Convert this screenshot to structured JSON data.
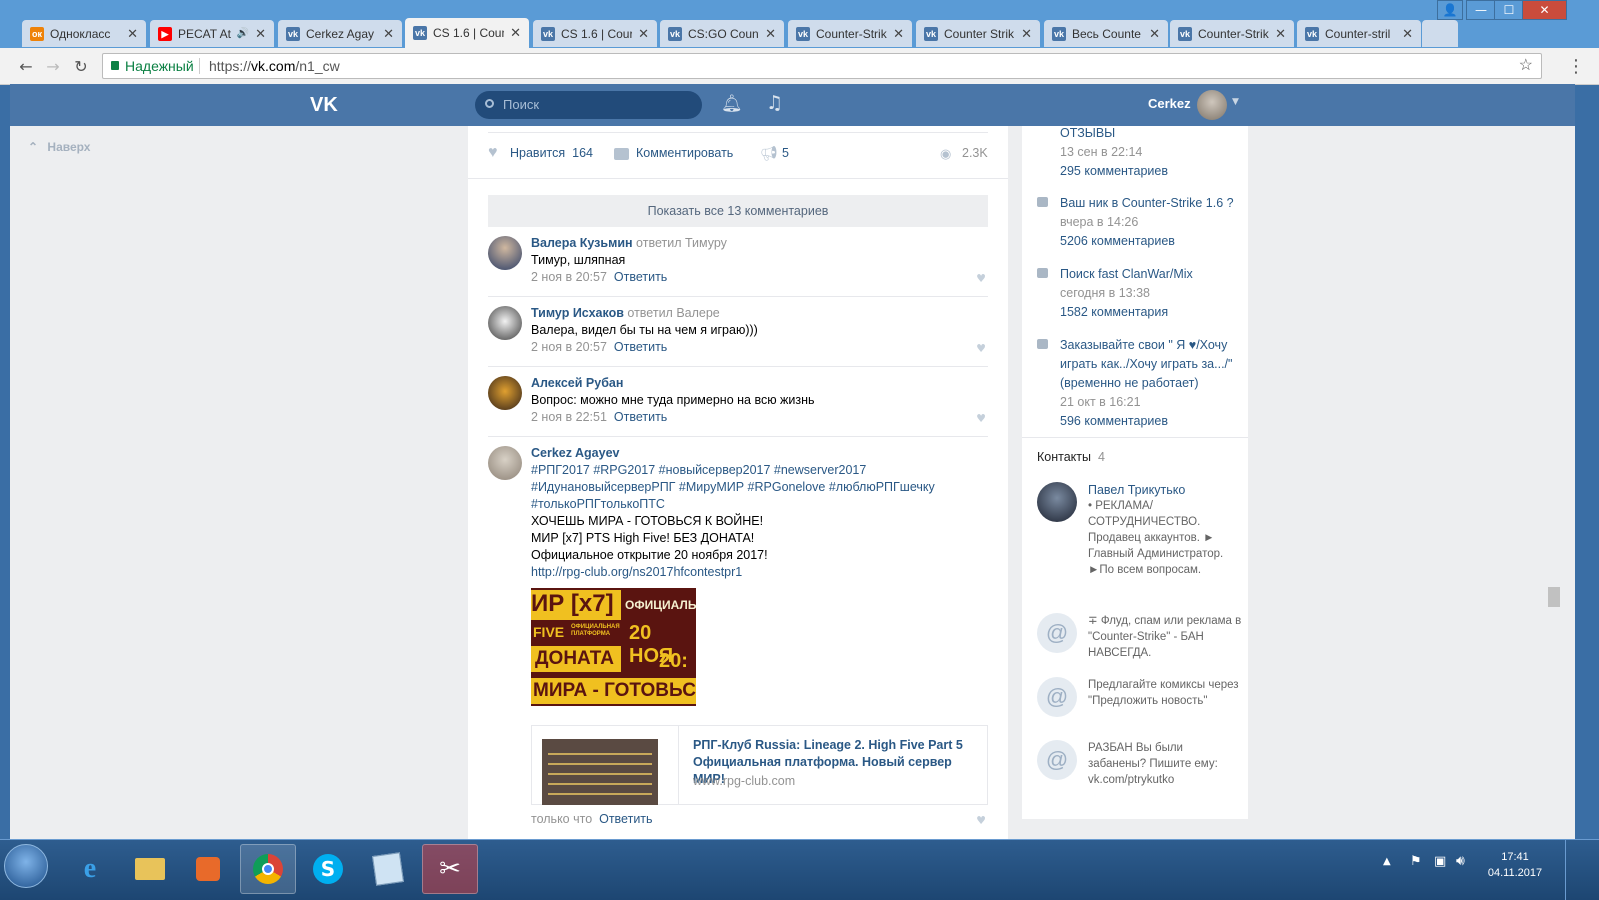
{
  "browser": {
    "tabs": [
      {
        "label": "Однокласс",
        "icon_color": "#ee8208",
        "icon_text": "ок"
      },
      {
        "label": "PECAT At",
        "icon_color": "#ff0000",
        "icon_text": "▶",
        "audio": "🔊"
      },
      {
        "label": "Cerkez Agay",
        "icon_color": "#4a76a8",
        "icon_text": "vk"
      },
      {
        "label": "CS 1.6 | Coun",
        "icon_color": "#4a76a8",
        "icon_text": "vk"
      },
      {
        "label": "CS 1.6 | Cour",
        "icon_color": "#4a76a8",
        "icon_text": "vk"
      },
      {
        "label": "CS:GO Count",
        "icon_color": "#4a76a8",
        "icon_text": "vk"
      },
      {
        "label": "Counter-Strik",
        "icon_color": "#4a76a8",
        "icon_text": "vk"
      },
      {
        "label": "Counter Strik",
        "icon_color": "#4a76a8",
        "icon_text": "vk"
      },
      {
        "label": "Весь Counte",
        "icon_color": "#4a76a8",
        "icon_text": "vk"
      },
      {
        "label": "Counter-Strik",
        "icon_color": "#4a76a8",
        "icon_text": "vk"
      },
      {
        "label": "Counter-stril",
        "icon_color": "#4a76a8",
        "icon_text": "vk"
      }
    ],
    "close_glyph": "✕",
    "window_buttons": {
      "minimize": "—",
      "maximize": "☐",
      "close": "✕"
    },
    "secure_label": "Надежный",
    "url_prefix": "https://",
    "url_host": "vk.com",
    "url_path": "/n1_cw",
    "star_glyph": "☆",
    "menu_glyph": "⋮",
    "back_glyph": "←",
    "forward_glyph": "→",
    "reload_glyph": "↻"
  },
  "vk": {
    "logo": "VK",
    "search_placeholder": "Поиск",
    "username": "Cerkez",
    "to_top": "Наверх",
    "accent": "#4a76a8"
  },
  "post_actions": {
    "like_label": "Нравится",
    "like_count": "164",
    "comment_label": "Комментировать",
    "share_count": "5",
    "views": "2.3K"
  },
  "show_all_comments": "Показать все 13 комментариев",
  "comments": [
    {
      "author": "Валера Кузьмин",
      "reply_to": "ответил Тимуру",
      "text": "Тимур, шляпная",
      "date": "2 ноя в 20:57",
      "reply": "Ответить"
    },
    {
      "author": "Тимур Исхаков",
      "reply_to": "ответил Валере",
      "text": "Валера, видел бы ты на чем я играю)))",
      "date": "2 ноя в 20:57",
      "reply": "Ответить"
    },
    {
      "author": "Алексей Рубан",
      "reply_to": "",
      "text": "Вопрос: можно мне туда примерно на всю жизнь",
      "date": "2 ноя в 22:51",
      "reply": "Ответить"
    }
  ],
  "last_comment": {
    "author": "Cerkez Agayev",
    "hashtags_1": "#РПГ2017 #RPG2017 #новыйсервер2017 #newserver2017",
    "hashtags_2": "#ИдунановыйсерверРПГ #МируМИР #RPGonelove #люблюРПГшечку",
    "hashtags_3": "#толькоРПГтолькоПТС",
    "line_1": "ХОЧЕШЬ МИРА - ГОТОВЬСЯ К ВОЙНЕ!",
    "line_2": "МИР [x7] PTS High Five! БЕЗ ДОНАТА!",
    "line_3": "Официальное открытие 20 ноября 2017!",
    "link": "http://rpg-club.org/ns2017hfcontestpr1",
    "banner": {
      "t1": "ИР [x7]",
      "t2": "ОФИЦИАЛЬ",
      "t3": "FIVE",
      "t4": "ОФИЦИАЛЬНАЯ ПЛАТФОРМА",
      "t5": "20 НОЯ",
      "t6": "ДОНАТА",
      "t7": "20:",
      "t8": "МИРА - ГОТОВЬС"
    },
    "snippet_title": "РПГ-Клуб Russia: Lineage 2. High Five Part 5 Официальная платформа. Новый сервер МИР!",
    "snippet_domain": "www.rpg-club.com",
    "date": "только что",
    "reply": "Ответить"
  },
  "topics_partial": {
    "title": "ОТЗЫВЫ",
    "date": "13 сен в 22:14",
    "comments": "295 комментариев"
  },
  "topics": [
    {
      "title": "Ваш ник в Counter-Strike 1.6 ?",
      "date": "вчера в 14:26",
      "comments": "5206 комментариев"
    },
    {
      "title": "Поиск fast ClanWar/Mix",
      "date": "сегодня в 13:38",
      "comments": "1582 комментария"
    },
    {
      "title": "Заказывайте свои \" Я ♥/Хочу играть как../Хочу играть за.../\" (временно не работает)",
      "date": "21 окт в 16:21",
      "comments": "596 комментариев"
    }
  ],
  "contacts": {
    "title": "Контакты",
    "count": "4",
    "items": [
      {
        "name": "Павел Трикутько",
        "desc": "• РЕКЛАМА/ СОТРУДНИЧЕСТВО. Продавец аккаунтов. ► Главный Администратор. ►По всем вопросам."
      },
      {
        "name": "",
        "desc": "∓ Флуд, спам или реклама в \"Counter-Strike\" - БАН НАВСЕГДА."
      },
      {
        "name": "",
        "desc": "Предлагайте комиксы через \"Предложить новость\""
      },
      {
        "name": "",
        "desc": "РАЗБАН Вы были забанены? Пишите ему: vk.com/ptrykutko"
      }
    ]
  },
  "taskbar": {
    "time": "17:41",
    "date": "04.11.2017"
  }
}
